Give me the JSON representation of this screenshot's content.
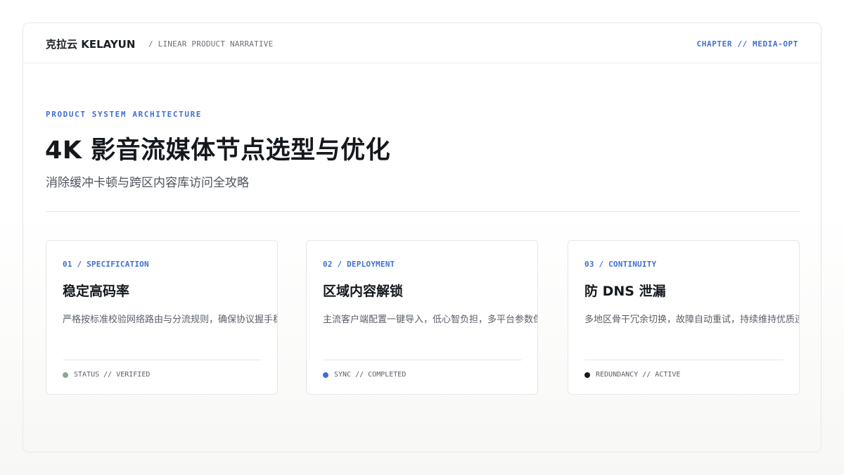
{
  "header": {
    "brand": "克拉云 KELAYUN",
    "narrative": "/ LINEAR PRODUCT NARRATIVE",
    "chapter": "CHAPTER // MEDIA-OPT"
  },
  "hero": {
    "eyebrow": "PRODUCT SYSTEM ARCHITECTURE",
    "title": "4K 影音流媒体节点选型与优化",
    "subtitle": "消除缓冲卡顿与跨区内容库访问全攻略"
  },
  "cards": [
    {
      "tag": "01 / SPECIFICATION",
      "title": "稳定高码率",
      "description": "严格按标准校验网络路由与分流规则，确保协议握手稳定",
      "status": "STATUS // VERIFIED",
      "dot_color": "#8fa596",
      "dot_icon": "status-dot-icon"
    },
    {
      "tag": "02 / DEPLOYMENT",
      "title": "区域内容解锁",
      "description": "主流客户端配置一键导入，低心智负担，多平台参数保持",
      "status": "SYNC // COMPLETED",
      "dot_color": "#3f6fd8",
      "dot_icon": "status-dot-icon"
    },
    {
      "tag": "03 / CONTINUITY",
      "title": "防 DNS 泄漏",
      "description": "多地区骨干冗余切换，故障自动重试，持续维持优质连接体验",
      "status": "REDUNDANCY // ACTIVE",
      "dot_color": "#15191e",
      "dot_icon": "status-dot-icon"
    }
  ]
}
